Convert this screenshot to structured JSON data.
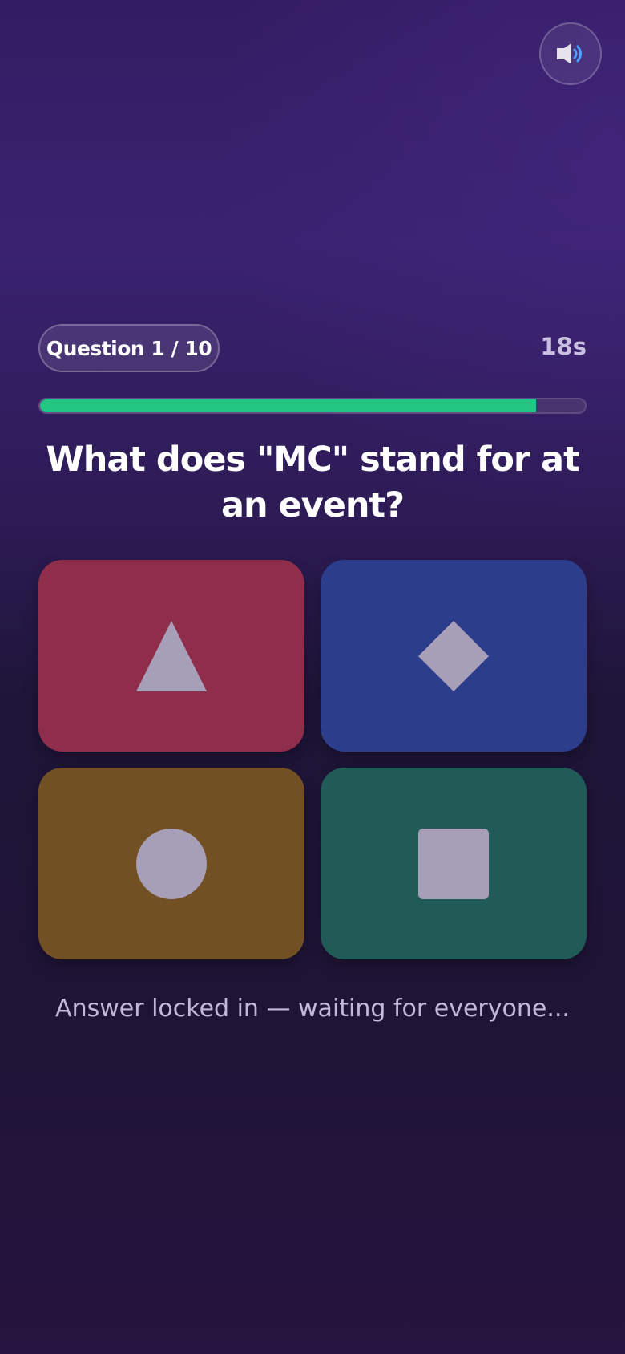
{
  "header": {
    "sound_icon": "speaker-icon"
  },
  "quiz": {
    "question_counter": "Question 1 / 10",
    "timer": "18s",
    "progress_fraction": 0.91,
    "progress_color": "#22c784",
    "question_text": "What does \"MC\" stand for at an event?"
  },
  "answers": [
    {
      "icon": "triangle-icon",
      "color": "#8f2e4a"
    },
    {
      "icon": "diamond-icon",
      "color": "#2c3d8c"
    },
    {
      "icon": "circle-icon",
      "color": "#715124"
    },
    {
      "icon": "square-icon",
      "color": "#215b57"
    }
  ],
  "shape_color": "#a79eb8",
  "status": {
    "message": "Answer locked in — waiting for everyone..."
  }
}
